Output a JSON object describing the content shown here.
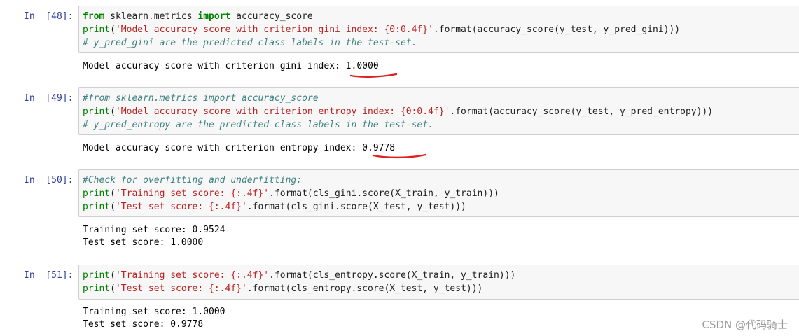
{
  "cells": [
    {
      "prompt": "In  [48]:",
      "code_lines": [
        [
          {
            "t": "kw",
            "v": "from"
          },
          {
            "t": "pl",
            "v": " sklearn.metrics "
          },
          {
            "t": "kw",
            "v": "import"
          },
          {
            "t": "pl",
            "v": " accuracy_score"
          }
        ],
        [
          {
            "t": "fn",
            "v": "print"
          },
          {
            "t": "pl",
            "v": "("
          },
          {
            "t": "str",
            "v": "'Model accuracy score with criterion gini index: {0:0.4f}'"
          },
          {
            "t": "pl",
            "v": ".format(accuracy_score(y_test, y_pred_gini)))"
          }
        ],
        [
          {
            "t": "cm",
            "v": "# y_pred_gini are the predicted class labels in the test-set."
          }
        ]
      ],
      "output_lines": [
        "Model accuracy score with criterion gini index: 1.0000"
      ]
    },
    {
      "prompt": "In  [49]:",
      "code_lines": [
        [
          {
            "t": "cm",
            "v": "#from sklearn.metrics import accuracy_score"
          }
        ],
        [
          {
            "t": "fn",
            "v": "print"
          },
          {
            "t": "pl",
            "v": "("
          },
          {
            "t": "str",
            "v": "'Model accuracy score with criterion entropy index: {0:0.4f}'"
          },
          {
            "t": "pl",
            "v": ".format(accuracy_score(y_test, y_pred_entropy)))"
          }
        ],
        [
          {
            "t": "cm",
            "v": "# y_pred_entropy are the predicted class labels in the test-set."
          }
        ]
      ],
      "output_lines": [
        "Model accuracy score with criterion entropy index: 0.9778"
      ]
    },
    {
      "prompt": "In  [50]:",
      "code_lines": [
        [
          {
            "t": "cm",
            "v": "#Check for overfitting and underfitting:"
          }
        ],
        [
          {
            "t": "fn",
            "v": "print"
          },
          {
            "t": "pl",
            "v": "("
          },
          {
            "t": "str",
            "v": "'Training set score: {:.4f}'"
          },
          {
            "t": "pl",
            "v": ".format(cls_gini.score(X_train, y_train)))"
          }
        ],
        [
          {
            "t": "fn",
            "v": "print"
          },
          {
            "t": "pl",
            "v": "("
          },
          {
            "t": "str",
            "v": "'Test set score: {:.4f}'"
          },
          {
            "t": "pl",
            "v": ".format(cls_gini.score(X_test, y_test)))"
          }
        ]
      ],
      "output_lines": [
        "Training set score: 0.9524",
        "Test set score: 1.0000"
      ]
    },
    {
      "prompt": "In  [51]:",
      "code_lines": [
        [
          {
            "t": "fn",
            "v": "print"
          },
          {
            "t": "pl",
            "v": "("
          },
          {
            "t": "str",
            "v": "'Training set score: {:.4f}'"
          },
          {
            "t": "pl",
            "v": ".format(cls_entropy.score(X_train, y_train)))"
          }
        ],
        [
          {
            "t": "fn",
            "v": "print"
          },
          {
            "t": "pl",
            "v": "("
          },
          {
            "t": "str",
            "v": "'Test set score: {:.4f}'"
          },
          {
            "t": "pl",
            "v": ".format(cls_entropy.score(X_test, y_test)))"
          }
        ]
      ],
      "output_lines": [
        "Training set score: 1.0000",
        "Test set score: 0.9778"
      ]
    }
  ],
  "watermark": "CSDN @代码骑士",
  "colors": {
    "prompt": "#303f9f",
    "keyword": "#008000",
    "string": "#ba2121",
    "comment": "#408080",
    "annotation": "#e02020",
    "cell_background": "#f7f7f7",
    "cell_border": "#cfcfcf"
  }
}
